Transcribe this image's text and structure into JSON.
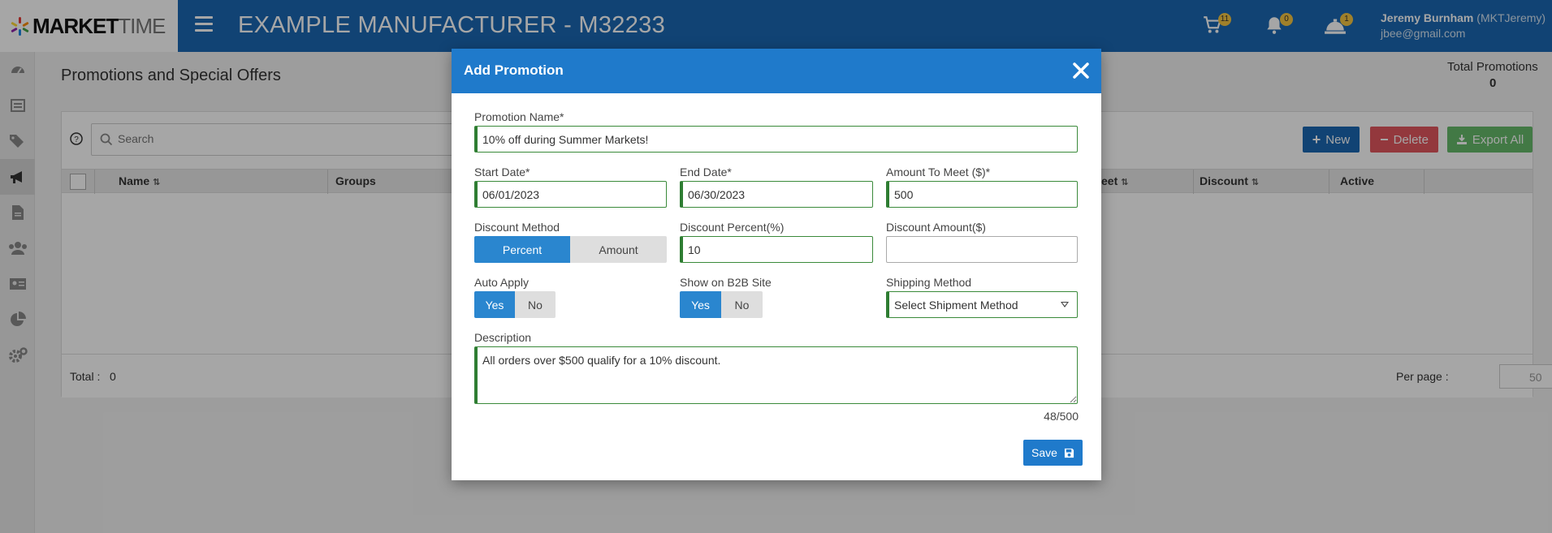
{
  "brand": {
    "logo_bold": "MARKET",
    "logo_light": "TIME"
  },
  "header": {
    "title": "EXAMPLE MANUFACTURER - M32233",
    "cart_count": "11",
    "notifications_count": "0",
    "alerts_count": "1",
    "user_name": "Jeremy Burnham",
    "user_handle": "(MKTJeremy)",
    "user_email": "jbee@gmail.com"
  },
  "page": {
    "title": "Promotions and Special Offers",
    "total_promotions_label": "Total Promotions",
    "total_promotions_value": "0"
  },
  "toolbar": {
    "search_placeholder": "Search",
    "new_label": "New",
    "delete_label": "Delete",
    "export_label": "Export All"
  },
  "grid": {
    "columns": [
      "Name",
      "Groups",
      "eet",
      "Discount",
      "Active"
    ],
    "total_label": "Total :",
    "total_value": "0",
    "per_page_label": "Per page :",
    "per_page_value": "50"
  },
  "modal": {
    "title": "Add Promotion",
    "promotion_name_label": "Promotion Name*",
    "promotion_name_value": "10% off during Summer Markets!",
    "start_date_label": "Start Date*",
    "start_date_value": "06/01/2023",
    "end_date_label": "End Date*",
    "end_date_value": "06/30/2023",
    "amount_label": "Amount To Meet ($)*",
    "amount_value": "500",
    "discount_method_label": "Discount Method",
    "discount_method_options": [
      "Percent",
      "Amount"
    ],
    "discount_percent_label": "Discount Percent(%)",
    "discount_percent_value": "10",
    "discount_amount_label": "Discount Amount($)",
    "discount_amount_value": "",
    "auto_apply_label": "Auto Apply",
    "auto_apply_options": [
      "Yes",
      "No"
    ],
    "show_b2b_label": "Show on B2B Site",
    "show_b2b_options": [
      "Yes",
      "No"
    ],
    "shipping_method_label": "Shipping Method",
    "shipping_method_value": "Select Shipment Method",
    "description_label": "Description",
    "description_value": "All orders over $500 qualify for a 10% discount.",
    "char_count": "48/500",
    "save_label": "Save"
  },
  "colors": {
    "header_bg": "#1b68b3",
    "modal_header_bg": "#1f7acb",
    "toggle_active": "#2a86cf",
    "required_border": "#2e7d32",
    "delete_button": "#e2575f",
    "export_button": "#66bb6a"
  }
}
